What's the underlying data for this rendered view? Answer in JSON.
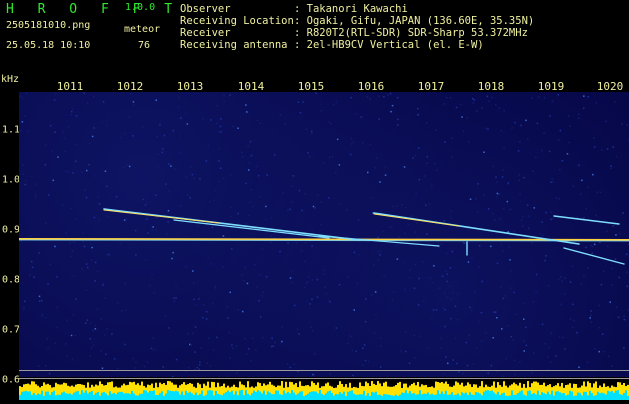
{
  "header": {
    "brand": "H R O F F T",
    "version": "1.0.0",
    "filename": "2505181010.png",
    "mode": "meteor",
    "datetime": "25.05.18 10:10",
    "count": "76",
    "rows": [
      {
        "key": "Observer",
        "value": ": Takanori Kawachi"
      },
      {
        "key": "Receiving Location",
        "value": ": Ogaki, Gifu, JAPAN (136.60E, 35.35N)"
      },
      {
        "key": "Receiver",
        "value": ": R820T2(RTL-SDR) SDR-Sharp 53.372MHz"
      },
      {
        "key": "Receiving antenna",
        "value": ": 2el-HB9CV Vertical (el. E-W)"
      }
    ]
  },
  "axis": {
    "unit": "kHz",
    "x_ticks": [
      "1011",
      "1012",
      "1013",
      "1014",
      "1015",
      "1016",
      "1017",
      "1018",
      "1019",
      "1020"
    ],
    "y_ticks": [
      "1.1",
      "1.0",
      "0.9",
      "0.8",
      "0.7",
      "0.6"
    ]
  },
  "colors": {
    "text": "#f0f0a0",
    "brand": "#2eea2e",
    "background": "#07084a",
    "carrier": "#ffd040",
    "trail": "#7fdfff",
    "histogram_yellow": "#ffe000",
    "histogram_cyan": "#00e0ff"
  }
}
